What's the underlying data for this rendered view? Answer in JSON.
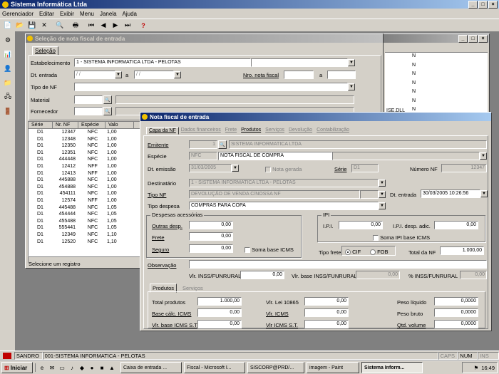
{
  "app": {
    "title": "Sistema Informática Ltda"
  },
  "menu": [
    "Gerenciador",
    "Editar",
    "Exibir",
    "Menu",
    "Janela",
    "Ajuda"
  ],
  "selecao": {
    "title": "Seleção de nota fiscal de entrada",
    "tab": "Seleção",
    "estabelecimento_label": "Estabelecimento",
    "estabelecimento": "1 - SISTEMA INFORMATICA LTDA - PELOTAS",
    "dt_entrada_label": "Dt. entrada",
    "date_ph": "/ /",
    "a_label": "a",
    "nro_nota_label": "Nro. nota fiscal",
    "tipo_nf_label": "Tipo de NF",
    "material_label": "Material",
    "fornecedor_label": "Fornecedor",
    "grid_headers": [
      "Série",
      "Nr. NF",
      "Espécie",
      "Valo"
    ],
    "rows": [
      [
        "D1",
        "12347",
        "NFC",
        "1,00"
      ],
      [
        "D1",
        "12348",
        "NFC",
        "1,00"
      ],
      [
        "D1",
        "12350",
        "NFC",
        "1,00"
      ],
      [
        "D1",
        "12351",
        "NFC",
        "1,00"
      ],
      [
        "D1",
        "444448",
        "NFC",
        "1,00"
      ],
      [
        "D1",
        "12412",
        "NFF",
        "1,00"
      ],
      [
        "D1",
        "12413",
        "NFF",
        "1,00"
      ],
      [
        "D1",
        "445888",
        "NFC",
        "1,00"
      ],
      [
        "D1",
        "454888",
        "NFC",
        "1,00"
      ],
      [
        "D1",
        "454111",
        "NFC",
        "1,00"
      ],
      [
        "D1",
        "12574",
        "NFF",
        "1,00"
      ],
      [
        "D1",
        "445488",
        "NFC",
        "1,05"
      ],
      [
        "D1",
        "454444",
        "NFC",
        "1,05"
      ],
      [
        "D1",
        "455488",
        "NFC",
        "1,05"
      ],
      [
        "D1",
        "555441",
        "NFC",
        "1,05"
      ],
      [
        "D1",
        "12349",
        "NFC",
        "1,10"
      ],
      [
        "D1",
        "12520",
        "NFC",
        "1,10"
      ]
    ],
    "status": "Selecione um registro"
  },
  "side_panel": {
    "items": [
      "N",
      "N",
      "N",
      "N",
      "N",
      "N",
      "N",
      "N",
      "N",
      "N",
      "N",
      "N"
    ],
    "label": "ISE.DLL"
  },
  "nota": {
    "title": "Nota fiscal de entrada",
    "tabs": [
      "Capa da NF",
      "Dados financeiros",
      "Frete",
      "Produtos",
      "Serviços",
      "Devolução",
      "Dados Lotes",
      "Contabilização"
    ],
    "emitente_label": "Emitente",
    "emitente_code": "1",
    "emitente_name": "SISTEMA INFORMATICA LTDA",
    "especie_label": "Espécie",
    "especie_code": "NFC",
    "especie_name": "NOTA FISCAL DE COMPRA",
    "dt_emissao_label": "Dt. emissão",
    "dt_emissao": "31/03/2005",
    "nota_gerada": "Nota gerada",
    "serie_label": "Série",
    "serie": "D1",
    "numero_label": "Número NF",
    "numero": "12347",
    "destinatario_label": "Destinatário",
    "destinatario": "1 - SISTEMA INFORMATICA LTDA - PELOTAS",
    "tipo_nf_label": "Tipo NF",
    "tipo_nf": "DEVOLUÇÃO DE VENDA C/NOSSA NF",
    "dt_entrada_label": "Dt. entrada",
    "dt_entrada": "30/03/2005 10:26:56",
    "tipo_despesa_label": "Tipo despesa",
    "tipo_despesa": "COMPRAS PARA COPA",
    "despesas_title": "Despesas acessórias",
    "outras_label": "Outras desp.",
    "outras": "0,00",
    "frete_label": "Frete",
    "frete": "0,00",
    "seguro_label": "Seguro",
    "seguro": "0,00",
    "soma_icms": "Soma base ICMS",
    "ipi_title": "IPI",
    "ipi_label": "I.P.I.",
    "ipi": "0,00",
    "ipi_adic_label": "I.P.I. desp. adic.",
    "ipi_adic": "0,00",
    "soma_ipi": "Soma IPI  base ICMS",
    "tipo_frete_label": "Tipo frete",
    "cif": "CIF",
    "fob": "FOB",
    "total_nf_label": "Total da NF",
    "total_nf": "1.000,00",
    "obs_label": "Observação",
    "inss_label": "Vlr. INSS/FUNRURAL",
    "inss": "0,00",
    "base_inss_label": "Vlr. base INSS/FUNRURAL",
    "base_inss": "0,00",
    "pct_inss_label": "% INSS/FUNRURAL",
    "pct_inss": "0,00",
    "sub_tabs": [
      "Produtos",
      "Serviços"
    ],
    "total_prod_label": "Total produtos",
    "total_prod": "1.000,00",
    "base_icms_label": "Base cálc. ICMS",
    "base_icms": "0,00",
    "base_icms_st_label": "Vlr. base ICMS S.T",
    "base_icms_st": "0,00",
    "lei_label": "Vlr. Lei 10865",
    "lei": "0,00",
    "icms_label": "Vlr. ICMS",
    "icms": "0,00",
    "icms_st_label": "Vlr ICMS S.T.",
    "icms_st": "0,00",
    "peso_liq_label": "Peso líquido",
    "peso_liq": "0,0000",
    "peso_bruto_label": "Peso bruto",
    "peso_bruto": "0,0000",
    "qtd_vol_label": "Qtd. volume",
    "qtd_vol": "0,0000"
  },
  "statusbar": {
    "user": "SANDRO",
    "company": "001-SISTEMA INFORMATICA - PELOTAS",
    "caps": "CAPS",
    "num": "NUM",
    "ins": "INS"
  },
  "taskbar": {
    "start": "Iniciar",
    "items": [
      "Caixa de entrada ...",
      "Fiscal - Microsoft I...",
      "SISCORP@PRD/...",
      "imagem - Paint",
      "Sistema Inform..."
    ],
    "clock": "16:49"
  }
}
